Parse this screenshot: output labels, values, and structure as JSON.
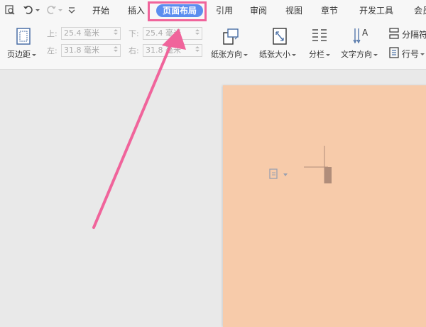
{
  "menu": {
    "tabs": [
      "开始",
      "插入",
      "页面布局",
      "引用",
      "审阅",
      "视图",
      "章节",
      "开发工具",
      "会员"
    ],
    "active_tab": "页面布局"
  },
  "ribbon": {
    "page_margin_label": "页边距",
    "margins": {
      "top_label": "上:",
      "top_value": "25.4 毫米",
      "bottom_label": "下:",
      "bottom_value": "25.4 毫米",
      "left_label": "左:",
      "left_value": "31.8 毫米",
      "right_label": "右:",
      "right_value": "31.8 毫米"
    },
    "orientation_label": "纸张方向",
    "size_label": "纸张大小",
    "columns_label": "分栏",
    "text_direction_label": "文字方向",
    "separator_label": "分隔符",
    "line_number_label": "行号"
  },
  "colors": {
    "active_tab_bg": "#5b8def",
    "highlight": "#f0649b",
    "page_bg": "#f7cbaa",
    "canvas_bg": "#e9e9e9"
  },
  "icons": [
    "print-preview-icon",
    "undo-icon",
    "redo-icon",
    "customize-icon",
    "margin-icon",
    "orientation-icon",
    "size-icon",
    "columns-icon",
    "text-direction-icon",
    "separator-icon",
    "line-number-icon",
    "paste-options-icon"
  ]
}
